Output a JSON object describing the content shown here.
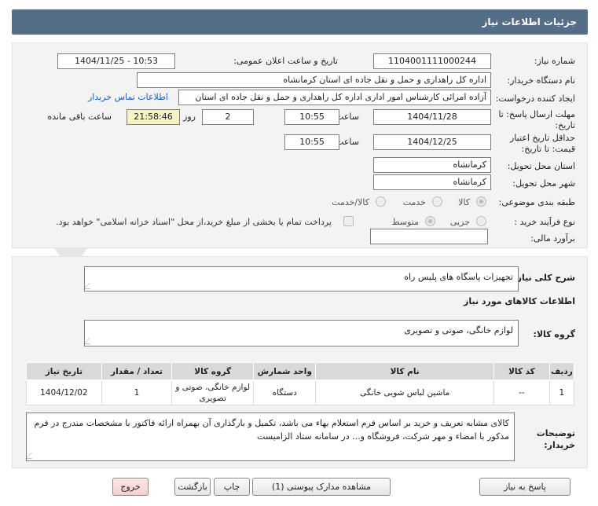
{
  "header": {
    "title": "جزئیات اطلاعات نیاز"
  },
  "form": {
    "need_number_label": "شماره نیاز:",
    "need_number": "1104001111000244",
    "announce_label": "تاریخ و ساعت اعلان عمومی:",
    "announce_value": "1404/11/25 - 10:53",
    "buyer_org_label": "نام دستگاه خریدار:",
    "buyer_org": "اداره کل راهداری و حمل و نقل جاده ای استان کرمانشاه",
    "creator_label": "ایجاد کننده درخواست:",
    "creator": "آزاده امرائی کارشناس امور اداری اداره کل راهداری و حمل و نقل جاده ای استان",
    "contact_link": "اطلاعات تماس خریدار",
    "deadline_label_1": "مهلت ارسال پاسخ: تا",
    "deadline_label_2": "تاریخ:",
    "deadline_date": "1404/11/28",
    "time_label": "ساعت",
    "deadline_time": "10:55",
    "days_value": "2",
    "days_label": "روز و",
    "remaining_time": "21:58:46",
    "remaining_label": "ساعت باقی مانده",
    "validity_label_1": "حداقل تاریخ اعتبار",
    "validity_label_2": "قیمت: تا تاریخ:",
    "validity_date": "1404/12/25",
    "validity_time": "10:55",
    "delivery_province_label": "استان محل تحویل:",
    "delivery_province": "کرمانشاه",
    "delivery_city_label": "شهر محل تحویل:",
    "delivery_city": "کرمانشاه",
    "category_label": "طبقه بندی موضوعی:",
    "category_options": [
      "کالا",
      "خدمت",
      "کالا/خدمت"
    ],
    "process_label": "نوع فرآیند خرید :",
    "process_options": [
      "جزیی",
      "متوسط"
    ],
    "payment_note": "پرداخت تمام یا بخشی از مبلغ خرید،از محل \"اسناد خزانه اسلامی\" خواهد بود.",
    "estimate_label": "برآورد مالی:",
    "estimate_value": ""
  },
  "details": {
    "desc_label": "شرح کلی نیاز:",
    "desc_value": "تجهیزات پاسگاه های پلیس راه",
    "items_heading": "اطلاعات کالاهای مورد نیاز",
    "group_label": "گروه کالا:",
    "group_value": "لوازم خانگی، صوتی و تصویری",
    "table": {
      "headers": [
        "ردیف",
        "کد کالا",
        "نام کالا",
        "واحد شمارش",
        "گروه کالا",
        "تعداد / مقدار",
        "تاریخ نیاز"
      ],
      "rows": [
        [
          "1",
          "--",
          "ماشین لباس شویی خانگی",
          "دستگاه",
          "لوازم خانگی، صوتی و تصویری",
          "1",
          "1404/12/02"
        ]
      ]
    },
    "buyer_notes_label_1": "توضیحات",
    "buyer_notes_label_2": "خریدار:",
    "buyer_notes": "کالای مشابه تعریف و خرید بر اساس فرم استعلام بهاء می باشد، تکمیل و بارگذاری آن بهمراه ارائه فاکتور با مشخصات مندرج در فرم مذکور با امضاء و مهر شرکت، فروشگاه و... در سامانه ستاد الزامیست"
  },
  "buttons": {
    "reply": "پاسخ به نیاز",
    "attachments": "مشاهده مدارک پیوستی (1)",
    "print": "چاپ",
    "back": "بازگشت",
    "exit": "خروج"
  },
  "colors": {
    "header_bg": "#546e88",
    "link": "#1a5fb4",
    "highlight": "#f5f2c3",
    "exit_button": "#f6cfcf"
  }
}
